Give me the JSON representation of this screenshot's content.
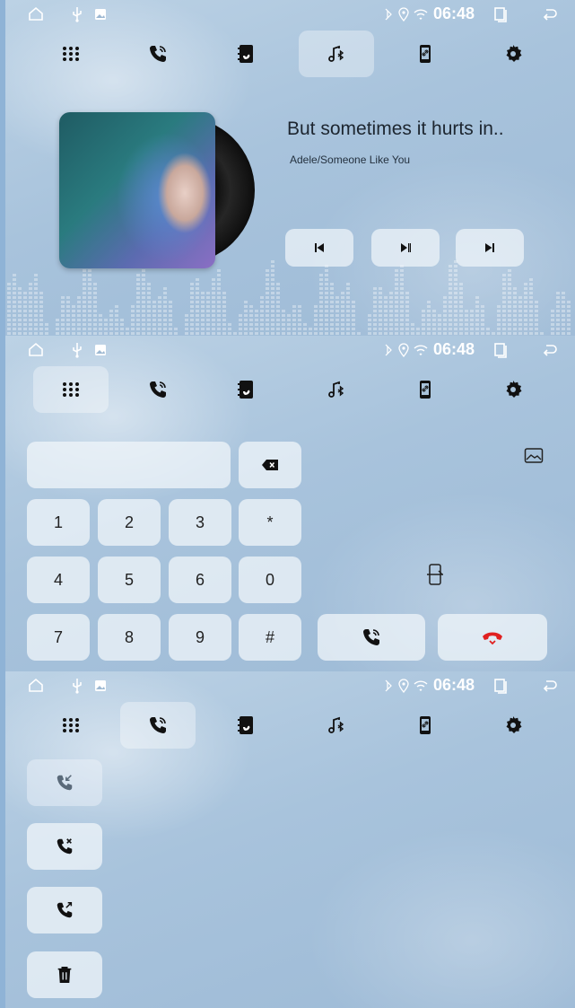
{
  "status": {
    "time": "06:48",
    "icons": [
      "home-outline-icon",
      "usb-icon",
      "gallery-icon",
      "bluetooth-icon",
      "location-icon",
      "wifi-icon",
      "recent-apps-icon",
      "back-icon"
    ]
  },
  "nav_tabs": [
    {
      "name": "dialpad",
      "icon": "dialpad-icon"
    },
    {
      "name": "calls",
      "icon": "phone-call-icon"
    },
    {
      "name": "contacts",
      "icon": "contacts-book-icon"
    },
    {
      "name": "bt-music",
      "icon": "bluetooth-music-icon"
    },
    {
      "name": "phone-link",
      "icon": "phone-link-icon"
    },
    {
      "name": "settings",
      "icon": "gear-icon"
    }
  ],
  "music": {
    "active_tab": "bt-music",
    "title": "But sometimes it hurts in..",
    "subtitle": "Adele/Someone Like You",
    "controls": [
      "previous-icon",
      "play-pause-icon",
      "next-icon"
    ]
  },
  "dialer": {
    "active_tab": "dialpad",
    "number_value": "",
    "keys": [
      "1",
      "2",
      "3",
      "*",
      "4",
      "5",
      "6",
      "0",
      "7",
      "8",
      "9",
      "#"
    ],
    "accent": "#e02020"
  },
  "calls": {
    "active_tab": "calls",
    "filters": [
      "incoming-call-icon",
      "missed-call-icon",
      "outgoing-call-icon",
      "trash-icon"
    ]
  }
}
